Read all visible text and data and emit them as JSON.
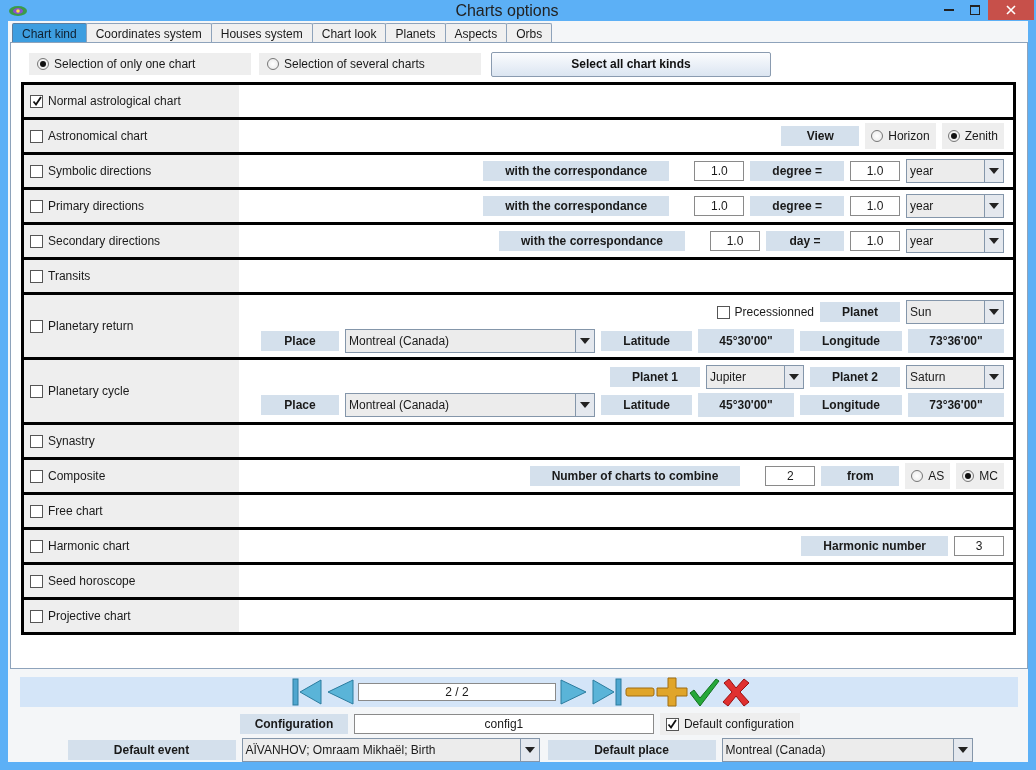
{
  "window": {
    "title": "Charts options"
  },
  "tabs": [
    {
      "label": "Chart kind",
      "selected": true
    },
    {
      "label": "Coordinates system",
      "selected": false
    },
    {
      "label": "Houses system",
      "selected": false
    },
    {
      "label": "Chart look",
      "selected": false
    },
    {
      "label": "Planets",
      "selected": false
    },
    {
      "label": "Aspects",
      "selected": false
    },
    {
      "label": "Orbs",
      "selected": false
    }
  ],
  "selection_modes": [
    {
      "label": "Selection of only one chart",
      "selected": true
    },
    {
      "label": "Selection of several charts",
      "selected": false
    }
  ],
  "select_all_button": "Select all chart kinds",
  "chart_kinds": [
    {
      "label": "Normal astrological chart",
      "checked": true
    },
    {
      "label": "Astronomical chart",
      "checked": false,
      "lines": [
        [
          {
            "kind": "label",
            "text": "View"
          },
          {
            "kind": "radio",
            "label": "Horizon",
            "selected": false
          },
          {
            "kind": "radio",
            "label": "Zenith",
            "selected": true
          }
        ]
      ]
    },
    {
      "label": "Symbolic directions",
      "checked": false,
      "lines": [
        [
          {
            "kind": "label",
            "text": "with the correspondance"
          },
          {
            "kind": "field",
            "value": "1.0"
          },
          {
            "kind": "label",
            "text": "degree ="
          },
          {
            "kind": "field",
            "value": "1.0"
          },
          {
            "kind": "combo",
            "value": "year"
          }
        ]
      ]
    },
    {
      "label": "Primary directions",
      "checked": false,
      "lines": [
        [
          {
            "kind": "label",
            "text": "with the correspondance"
          },
          {
            "kind": "field",
            "value": "1.0"
          },
          {
            "kind": "label",
            "text": "degree ="
          },
          {
            "kind": "field",
            "value": "1.0"
          },
          {
            "kind": "combo",
            "value": "year"
          }
        ]
      ]
    },
    {
      "label": "Secondary directions",
      "checked": false,
      "lines": [
        [
          {
            "kind": "label",
            "text": "with the correspondance"
          },
          {
            "kind": "field",
            "value": "1.0"
          },
          {
            "kind": "label",
            "text": "day ="
          },
          {
            "kind": "field",
            "value": "1.0"
          },
          {
            "kind": "combo",
            "value": "year"
          }
        ]
      ]
    },
    {
      "label": "Transits",
      "checked": false
    },
    {
      "label": "Planetary return",
      "checked": false,
      "lines": [
        [
          {
            "kind": "checkbox",
            "label": "Precessionned",
            "checked": false
          },
          {
            "kind": "label",
            "text": "Planet"
          },
          {
            "kind": "combo",
            "value": "Sun"
          }
        ],
        [
          {
            "kind": "label",
            "text": "Place"
          },
          {
            "kind": "combo",
            "value": "Montreal (Canada)"
          },
          {
            "kind": "label",
            "text": "Latitude"
          },
          {
            "kind": "value",
            "text": "45°30'00\""
          },
          {
            "kind": "label",
            "text": "Longitude"
          },
          {
            "kind": "value",
            "text": "73°36'00\""
          }
        ]
      ]
    },
    {
      "label": "Planetary cycle",
      "checked": false,
      "lines": [
        [
          {
            "kind": "label",
            "text": "Planet 1"
          },
          {
            "kind": "combo",
            "value": "Jupiter"
          },
          {
            "kind": "label",
            "text": "Planet 2"
          },
          {
            "kind": "combo",
            "value": "Saturn"
          }
        ],
        [
          {
            "kind": "label",
            "text": "Place"
          },
          {
            "kind": "combo",
            "value": "Montreal (Canada)"
          },
          {
            "kind": "label",
            "text": "Latitude"
          },
          {
            "kind": "value",
            "text": "45°30'00\""
          },
          {
            "kind": "label",
            "text": "Longitude"
          },
          {
            "kind": "value",
            "text": "73°36'00\""
          }
        ]
      ]
    },
    {
      "label": "Synastry",
      "checked": false
    },
    {
      "label": "Composite",
      "checked": false,
      "lines": [
        [
          {
            "kind": "label",
            "text": "Number of charts to combine"
          },
          {
            "kind": "field",
            "value": "2"
          },
          {
            "kind": "label",
            "text": "from"
          },
          {
            "kind": "radio",
            "label": "AS",
            "selected": false
          },
          {
            "kind": "radio",
            "label": "MC",
            "selected": true
          }
        ]
      ]
    },
    {
      "label": "Free chart",
      "checked": false
    },
    {
      "label": "Harmonic chart",
      "checked": false,
      "lines": [
        [
          {
            "kind": "label",
            "text": "Harmonic number"
          },
          {
            "kind": "field",
            "value": "3"
          }
        ]
      ]
    },
    {
      "label": "Seed horoscope",
      "checked": false
    },
    {
      "label": "Projective chart",
      "checked": false
    }
  ],
  "navigator": {
    "page": "2 / 2"
  },
  "configuration": {
    "label": "Configuration",
    "value": "config1",
    "default_label": "Default configuration",
    "default_checked": true
  },
  "default_event": {
    "label": "Default event",
    "value": "AÏVANHOV; Omraam Mikhaël; Birth"
  },
  "default_place": {
    "label": "Default place",
    "value": "Montreal (Canada)"
  }
}
